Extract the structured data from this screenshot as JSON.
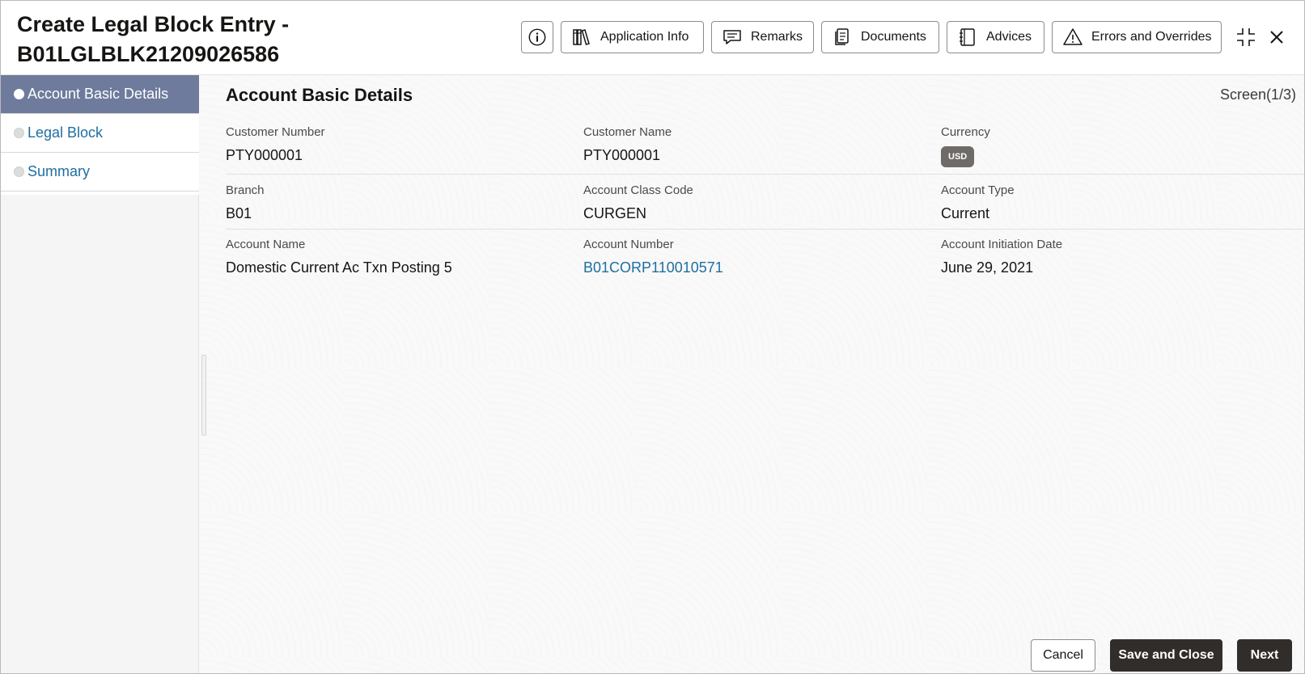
{
  "header": {
    "title_line1": "Create Legal Block Entry -",
    "title_line2": "B01LGLBLK21209026586",
    "toolbar": {
      "info_icon": "info-icon",
      "application_info": "Application Info",
      "remarks": "Remarks",
      "documents": "Documents",
      "advices": "Advices",
      "errors_and_overrides": "Errors and Overrides",
      "minimize_icon": "collapse-icon",
      "close_icon": "close-icon"
    }
  },
  "sidebar": {
    "items": [
      {
        "label": "Account Basic Details",
        "active": true
      },
      {
        "label": "Legal Block",
        "active": false
      },
      {
        "label": "Summary",
        "active": false
      }
    ]
  },
  "main": {
    "section_title": "Account Basic Details",
    "screen_indicator": "Screen(1/3)",
    "fields": {
      "customer_number": {
        "label": "Customer Number",
        "value": "PTY000001"
      },
      "customer_name": {
        "label": "Customer Name",
        "value": "PTY000001"
      },
      "currency": {
        "label": "Currency",
        "value": "USD"
      },
      "branch": {
        "label": "Branch",
        "value": "B01"
      },
      "account_class_code": {
        "label": "Account Class Code",
        "value": "CURGEN"
      },
      "account_type": {
        "label": "Account Type",
        "value": "Current"
      },
      "account_name": {
        "label": "Account Name",
        "value": "Domestic Current Ac Txn Posting 5"
      },
      "account_number": {
        "label": "Account Number",
        "value": "B01CORP110010571"
      },
      "account_initiation_date": {
        "label": "Account Initiation Date",
        "value": "June 29, 2021"
      }
    }
  },
  "footer": {
    "cancel": "Cancel",
    "save_and_close": "Save and Close",
    "next": "Next"
  },
  "colors": {
    "active_nav": "#6e7b9c",
    "link": "#1f6ea0",
    "primary_button": "#312d2a",
    "badge": "#6f6b67"
  }
}
